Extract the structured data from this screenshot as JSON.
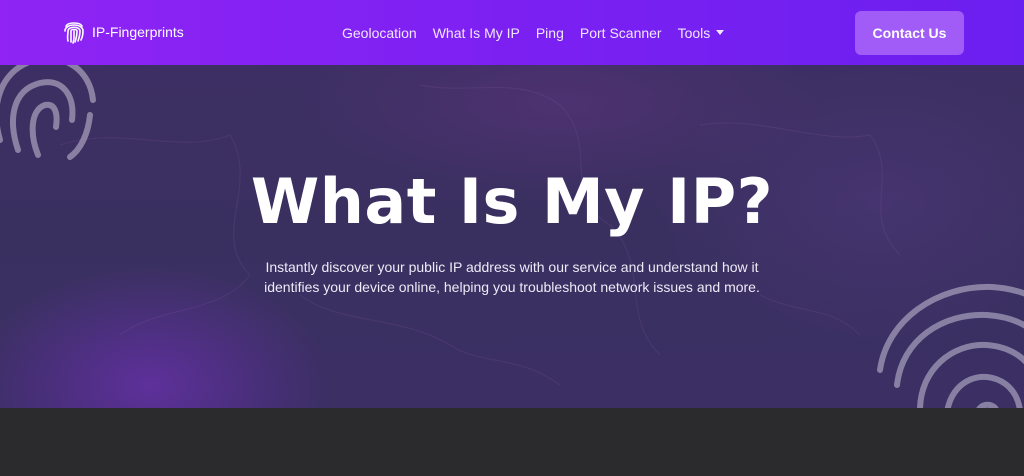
{
  "brand": {
    "name": "IP-Fingerprints",
    "logo_icon": "fingerprint-icon"
  },
  "nav": {
    "items": [
      {
        "label": "Geolocation"
      },
      {
        "label": "What Is My IP"
      },
      {
        "label": "Ping"
      },
      {
        "label": "Port Scanner"
      },
      {
        "label": "Tools"
      }
    ],
    "contact_label": "Contact Us"
  },
  "hero": {
    "title": "What Is My IP?",
    "description": "Instantly discover your public IP address with our service and understand how it identifies your device online, helping you troubleshoot network issues and more."
  },
  "colors": {
    "nav_bg": "#8f24f4",
    "contact_bg": "#a15cf7",
    "hero_bg": "#3b2f64",
    "page_bg": "#2b2b2e"
  }
}
